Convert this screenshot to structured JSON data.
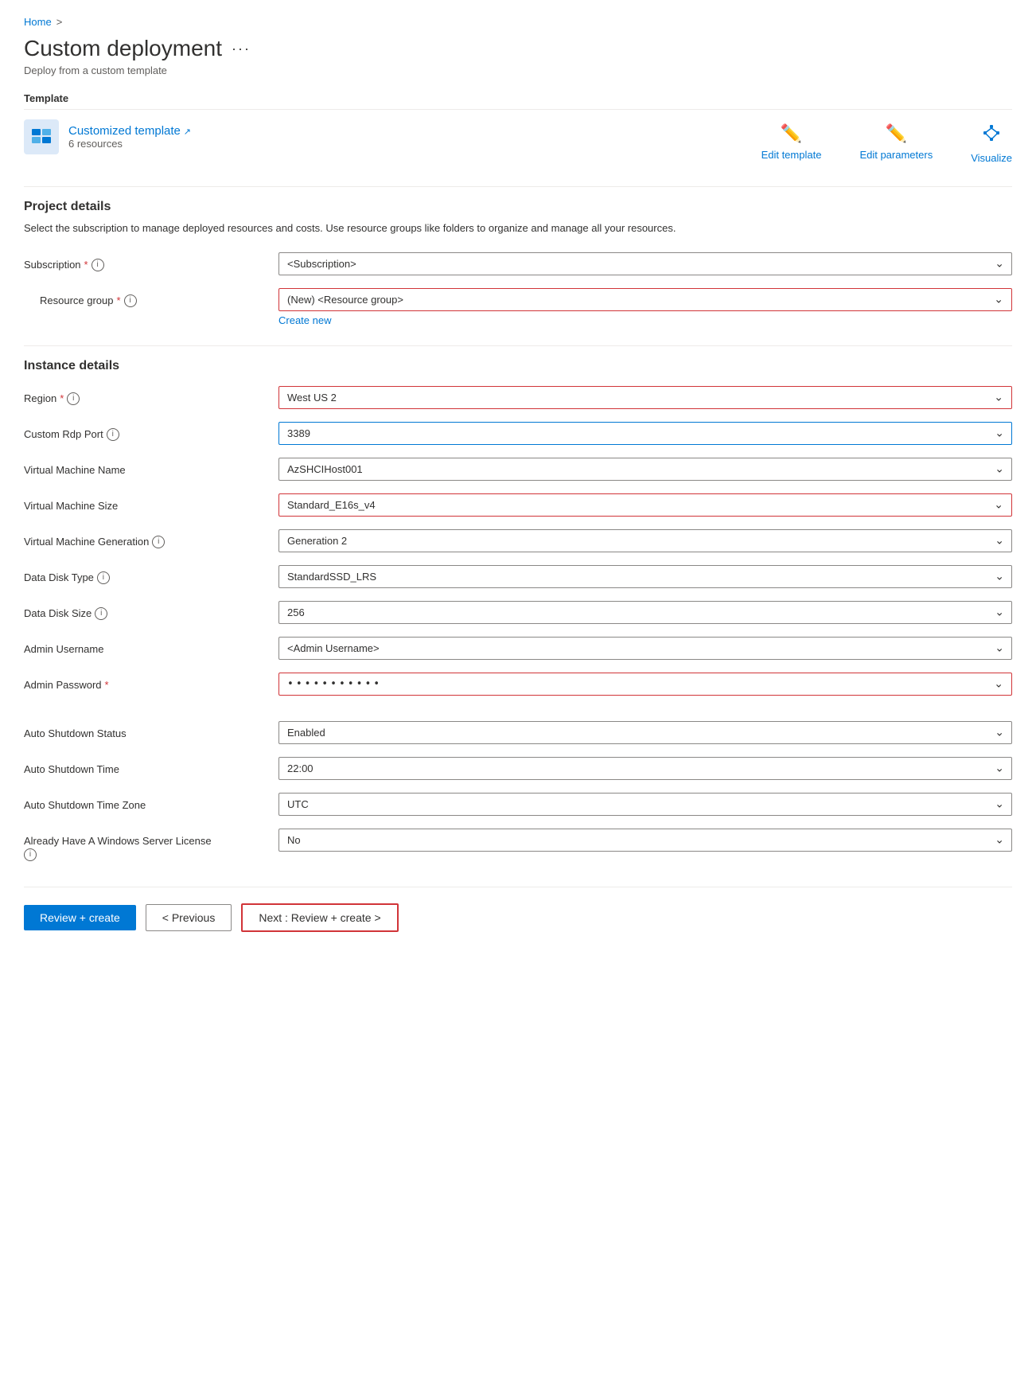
{
  "breadcrumb": {
    "home": "Home",
    "separator": ">"
  },
  "page": {
    "title": "Custom deployment",
    "ellipsis": "···",
    "subtitle": "Deploy from a custom template"
  },
  "template_section": {
    "header": "Template",
    "template_name": "Customized template",
    "template_link_icon": "↗",
    "resources_count": "6 resources",
    "edit_template_label": "Edit template",
    "edit_parameters_label": "Edit parameters",
    "visualize_label": "Visualize"
  },
  "project_details": {
    "title": "Project details",
    "description": "Select the subscription to manage deployed resources and costs. Use resource groups like folders to organize and manage all your resources.",
    "subscription_label": "Subscription",
    "subscription_required": true,
    "subscription_value": "<Subscription>",
    "resource_group_label": "Resource group",
    "resource_group_required": true,
    "resource_group_value": "(New) <Resource group>",
    "create_new_label": "Create new"
  },
  "instance_details": {
    "title": "Instance details",
    "region_label": "Region",
    "region_required": true,
    "region_value": "West US 2",
    "custom_rdp_port_label": "Custom Rdp Port",
    "custom_rdp_port_value": "3389",
    "vm_name_label": "Virtual Machine Name",
    "vm_name_value": "AzSHCIHost001",
    "vm_size_label": "Virtual Machine Size",
    "vm_size_required": false,
    "vm_size_value": "Standard_E16s_v4",
    "vm_generation_label": "Virtual Machine Generation",
    "vm_generation_value": "Generation 2",
    "data_disk_type_label": "Data Disk Type",
    "data_disk_type_value": "StandardSSD_LRS",
    "data_disk_size_label": "Data Disk Size",
    "data_disk_size_value": "256",
    "admin_username_label": "Admin Username",
    "admin_username_value": "<Admin Username>",
    "admin_password_label": "Admin Password",
    "admin_password_required": true,
    "admin_password_value": "···········",
    "auto_shutdown_status_label": "Auto Shutdown Status",
    "auto_shutdown_status_value": "Enabled",
    "auto_shutdown_time_label": "Auto Shutdown Time",
    "auto_shutdown_time_value": "22:00",
    "auto_shutdown_timezone_label": "Auto Shutdown Time Zone",
    "auto_shutdown_timezone_value": "UTC",
    "already_windows_label": "Already Have A Windows Server License",
    "already_windows_value": "No"
  },
  "footer": {
    "review_create_label": "Review + create",
    "previous_label": "< Previous",
    "next_label": "Next : Review + create >"
  }
}
